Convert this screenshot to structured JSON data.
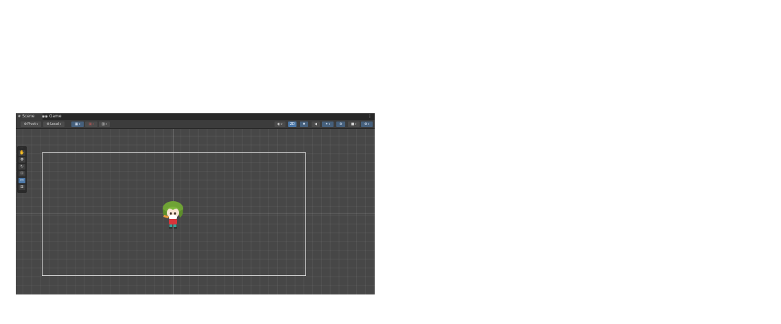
{
  "tabs": {
    "scene_label": "Scene",
    "game_label": "Game",
    "more_glyph": "⋮"
  },
  "toolbar": {
    "pivot_label": "Pivot",
    "local_label": "Local",
    "mode_2d_label": "2D",
    "dropdown_caret": "▾"
  },
  "tools": [
    "hand-tool",
    "move-tool",
    "rotate-tool",
    "scale-tool",
    "rect-tool",
    "transform-tool"
  ],
  "scene": {
    "object": "chibi-character-sprite"
  },
  "colors": {
    "panel_bg": "#474747",
    "tabbar_bg": "#282828",
    "toolbar_bg": "#3c3c3c",
    "accent_blue": "#4c78a8",
    "camera_frame": "#d4d4d4"
  }
}
